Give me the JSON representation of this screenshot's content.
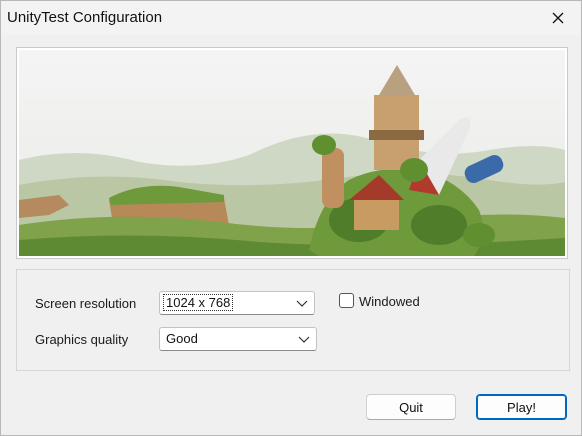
{
  "window": {
    "title": "UnityTest Configuration"
  },
  "icons": {
    "close": "close-icon",
    "dropdown": "chevron-down-icon"
  },
  "settings": {
    "resolution_label": "Screen resolution",
    "resolution_value": "1024 x 768",
    "quality_label": "Graphics quality",
    "quality_value": "Good",
    "windowed_label": "Windowed",
    "windowed_checked": false
  },
  "buttons": {
    "quit": "Quit",
    "play": "Play!"
  },
  "colors": {
    "accent": "#0067c0"
  }
}
